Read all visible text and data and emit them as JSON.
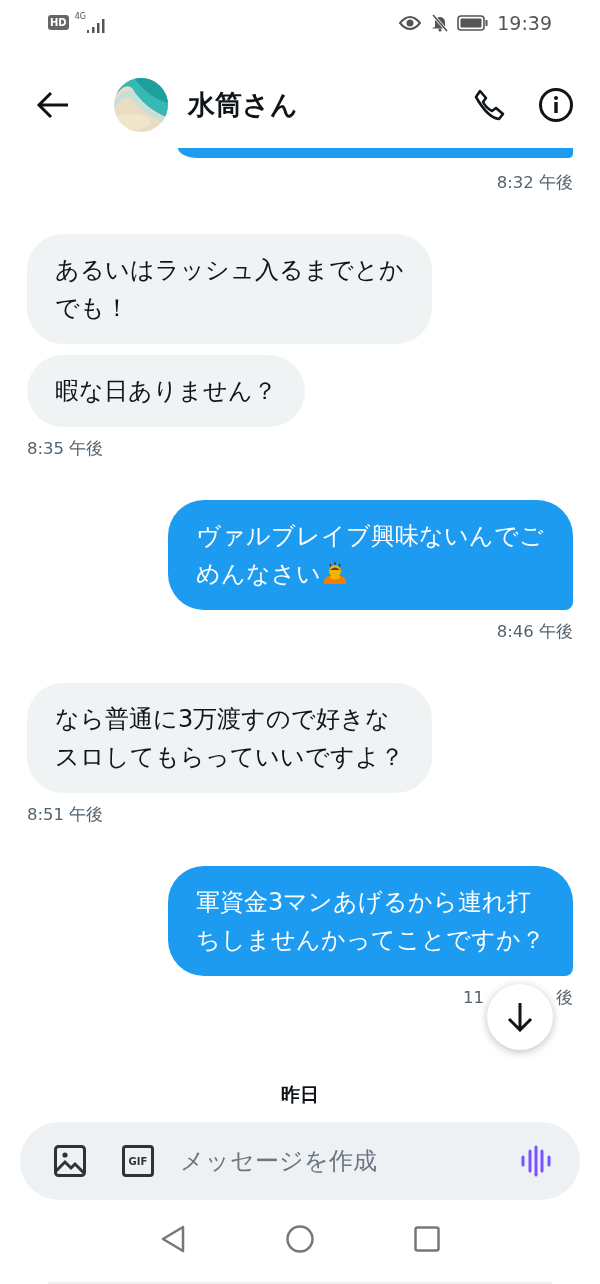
{
  "status_bar": {
    "hd_badge": "HD",
    "network": "4G",
    "time": "19:39"
  },
  "header": {
    "title": "水筒さん"
  },
  "messages": [
    {
      "kind": "outgoing_clipped",
      "time": "8:32 午後"
    },
    {
      "kind": "incoming",
      "bubbles": [
        {
          "text": "あるいはラッシュ入るまでとかでも！"
        },
        {
          "text": "暇な日ありません？"
        }
      ],
      "time": "8:35 午後"
    },
    {
      "kind": "outgoing",
      "bubbles": [
        {
          "text": "ヴァルブレイブ興味ないんでごめんなさい",
          "bowing_emoji": true
        }
      ],
      "time": "8:46 午後"
    },
    {
      "kind": "incoming",
      "bubbles": [
        {
          "text": "なら普通に3万渡すので好きなスロしてもらっていいですよ？"
        }
      ],
      "time": "8:51 午後"
    },
    {
      "kind": "outgoing",
      "bubbles": [
        {
          "text": "軍資金3マンあげるから連れ打ちしませんかってことですか？"
        }
      ],
      "time": "11",
      "time_end": "後",
      "scroll_button": true
    }
  ],
  "date_divider": "昨日",
  "composer": {
    "placeholder": "メッセージを作成",
    "gif_label": "GIF"
  }
}
